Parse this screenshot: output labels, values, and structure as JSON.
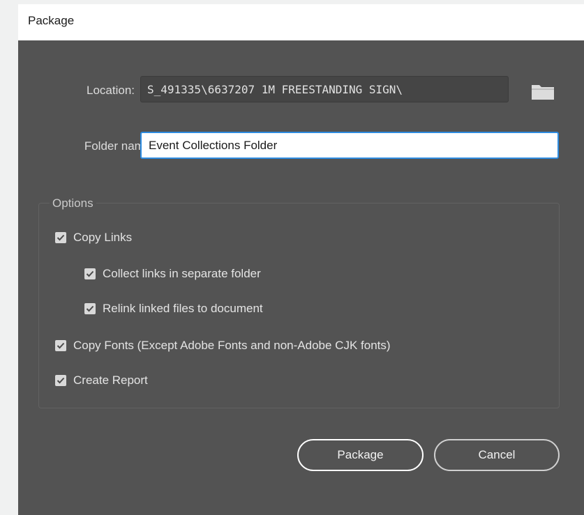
{
  "window": {
    "title": "Package"
  },
  "location": {
    "label": "Location:",
    "value": "S_491335\\6637207 1M FREESTANDING SIGN\\"
  },
  "folder_name": {
    "label": "Folder name:",
    "value": "Event Collections Folder"
  },
  "options": {
    "legend": "Options",
    "items": [
      {
        "label": "Copy Links",
        "checked": true
      },
      {
        "label": "Collect links in separate folder",
        "checked": true
      },
      {
        "label": "Relink linked files to document",
        "checked": true
      },
      {
        "label": "Copy Fonts (Except Adobe Fonts and non-Adobe CJK fonts)",
        "checked": true
      },
      {
        "label": "Create Report",
        "checked": true
      }
    ]
  },
  "buttons": {
    "package_label": "Package",
    "cancel_label": "Cancel"
  },
  "icons": {
    "browse": "folder-icon",
    "checkbox": "checkmark-icon"
  },
  "colors": {
    "dialog_bg": "#535353",
    "focus_border": "#2e8ce0"
  }
}
